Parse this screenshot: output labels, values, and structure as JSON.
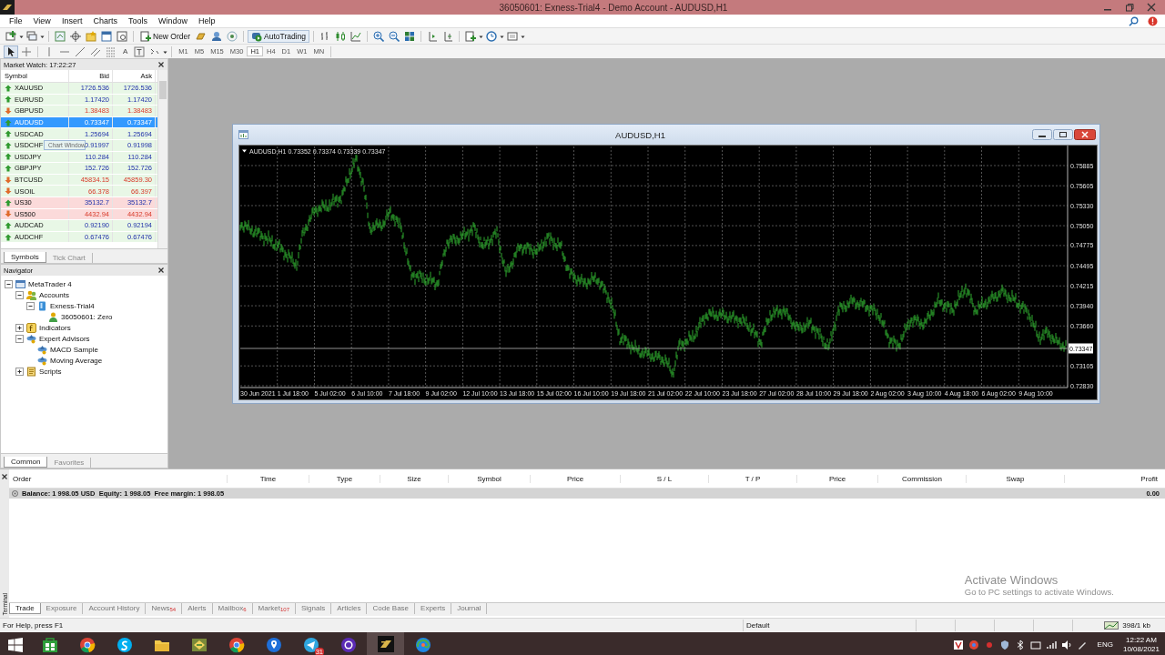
{
  "window": {
    "title": "36050601: Exness-Trial4 - Demo Account - AUDUSD,H1"
  },
  "menu": [
    "File",
    "View",
    "Insert",
    "Charts",
    "Tools",
    "Window",
    "Help"
  ],
  "toolbar": {
    "new_order": "New Order",
    "auto_trading": "AutoTrading",
    "text_tool": "A",
    "timeframes": [
      {
        "label": "M1",
        "selected": false
      },
      {
        "label": "M5",
        "selected": false
      },
      {
        "label": "M15",
        "selected": false
      },
      {
        "label": "M30",
        "selected": false
      },
      {
        "label": "H1",
        "selected": true
      },
      {
        "label": "H4",
        "selected": false
      },
      {
        "label": "D1",
        "selected": false
      },
      {
        "label": "W1",
        "selected": false
      },
      {
        "label": "MN",
        "selected": false
      }
    ]
  },
  "market_watch": {
    "title": "Market Watch: 17:22:27",
    "columns": [
      "Symbol",
      "Bid",
      "Ask"
    ],
    "rows": [
      {
        "symbol": "XAUUSD",
        "bid": "1726.536",
        "ask": "1726.536",
        "rising": true,
        "flagged": false,
        "selected": false
      },
      {
        "symbol": "EURUSD",
        "bid": "1.17420",
        "ask": "1.17420",
        "rising": true,
        "flagged": false,
        "selected": false
      },
      {
        "symbol": "GBPUSD",
        "bid": "1.38483",
        "ask": "1.38483",
        "rising": false,
        "flagged": false,
        "selected": false
      },
      {
        "symbol": "AUDUSD",
        "bid": "0.73347",
        "ask": "0.73347",
        "rising": true,
        "flagged": false,
        "selected": true
      },
      {
        "symbol": "USDCAD",
        "bid": "1.25694",
        "ask": "1.25694",
        "rising": true,
        "flagged": false,
        "selected": false
      },
      {
        "symbol": "USDCHF",
        "bid": "0.91997",
        "ask": "0.91998",
        "rising": true,
        "flagged": false,
        "selected": false
      },
      {
        "symbol": "USDJPY",
        "bid": "110.284",
        "ask": "110.284",
        "rising": true,
        "flagged": false,
        "selected": false
      },
      {
        "symbol": "GBPJPY",
        "bid": "152.726",
        "ask": "152.726",
        "rising": true,
        "flagged": false,
        "selected": false
      },
      {
        "symbol": "BTCUSD",
        "bid": "45834.15",
        "ask": "45859.30",
        "rising": false,
        "flagged": false,
        "selected": false
      },
      {
        "symbol": "USOIL",
        "bid": "66.378",
        "ask": "66.397",
        "rising": false,
        "flagged": false,
        "selected": false
      },
      {
        "symbol": "US30",
        "bid": "35132.7",
        "ask": "35132.7",
        "rising": true,
        "flagged": true,
        "selected": false
      },
      {
        "symbol": "US500",
        "bid": "4432.94",
        "ask": "4432.94",
        "rising": false,
        "flagged": true,
        "selected": false
      },
      {
        "symbol": "AUDCAD",
        "bid": "0.92190",
        "ask": "0.92194",
        "rising": true,
        "flagged": false,
        "selected": false
      },
      {
        "symbol": "AUDCHF",
        "bid": "0.67476",
        "ask": "0.67476",
        "rising": true,
        "flagged": false,
        "selected": false
      }
    ],
    "tabs": [
      {
        "label": "Symbols",
        "selected": true
      },
      {
        "label": "Tick Chart",
        "selected": false
      }
    ]
  },
  "drag_ghost": {
    "label": "Chart Window"
  },
  "navigator": {
    "title": "Navigator",
    "tree": [
      {
        "label": "MetaTrader 4",
        "kind": "terminal",
        "expanded": true,
        "children": [
          {
            "label": "Accounts",
            "kind": "accounts",
            "expanded": true,
            "children": [
              {
                "label": "Exness-Trial4",
                "kind": "server",
                "expanded": true,
                "children": [
                  {
                    "label": "36050601: Zero",
                    "kind": "account"
                  }
                ]
              }
            ]
          },
          {
            "label": "Indicators",
            "kind": "indicators",
            "expanded": false
          },
          {
            "label": "Expert Advisors",
            "kind": "experts",
            "expanded": true,
            "children": [
              {
                "label": "MACD Sample",
                "kind": "expert"
              },
              {
                "label": "Moving Average",
                "kind": "expert"
              }
            ]
          },
          {
            "label": "Scripts",
            "kind": "scripts",
            "expanded": false
          }
        ]
      }
    ],
    "tabs": [
      {
        "label": "Common",
        "selected": true
      },
      {
        "label": "Favorites",
        "selected": false
      }
    ]
  },
  "chart_window": {
    "title": "AUDUSD,H1",
    "info": "AUDUSD,H1  0.73352 0.73374 0.73339 0.73347",
    "price_labels": [
      "0.75885",
      "0.75605",
      "0.75330",
      "0.75050",
      "0.74775",
      "0.74495",
      "0.74215",
      "0.73940",
      "0.73660",
      "0.73105",
      "0.72830"
    ],
    "current_price": "0.73347",
    "time_labels": [
      "30 Jun 2021",
      "1 Jul 18:00",
      "5 Jul 02:00",
      "6 Jul 10:00",
      "7 Jul 18:00",
      "9 Jul 02:00",
      "12 Jul 10:00",
      "13 Jul 18:00",
      "15 Jul 02:00",
      "16 Jul 10:00",
      "19 Jul 18:00",
      "21 Jul 02:00",
      "22 Jul 10:00",
      "23 Jul 18:00",
      "27 Jul 02:00",
      "28 Jul 10:00",
      "29 Jul 18:00",
      "2 Aug 02:00",
      "3 Aug 10:00",
      "4 Aug 18:00",
      "6 Aug 02:00",
      "9 Aug 10:00"
    ]
  },
  "terminal": {
    "label": "Terminal",
    "columns": [
      "Order",
      "Time",
      "Type",
      "Size",
      "Symbol",
      "Price",
      "S / L",
      "T / P",
      "Price",
      "Commission",
      "Swap",
      "Profit"
    ],
    "balance": "Balance: 1 998.05 USD  Equity: 1 998.05  Free margin: 1 998.05",
    "profit": "0.00",
    "tabs": [
      {
        "label": "Trade",
        "selected": true
      },
      {
        "label": "Exposure",
        "selected": false
      },
      {
        "label": "Account History",
        "selected": false
      },
      {
        "label": "News",
        "badge": "54",
        "selected": false
      },
      {
        "label": "Alerts",
        "selected": false
      },
      {
        "label": "Mailbox",
        "badge": "6",
        "selected": false
      },
      {
        "label": "Market",
        "badge": "107",
        "selected": false
      },
      {
        "label": "Signals",
        "selected": false
      },
      {
        "label": "Articles",
        "selected": false
      },
      {
        "label": "Code Base",
        "selected": false
      },
      {
        "label": "Experts",
        "selected": false
      },
      {
        "label": "Journal",
        "selected": false
      }
    ]
  },
  "activation_notice": {
    "title": "Activate Windows",
    "text": "Go to PC settings to activate Windows."
  },
  "status_bar": {
    "help": "For Help, press F1",
    "profile": "Default",
    "traffic": "398/1 kb"
  },
  "taskbar": {
    "apps": [
      {
        "kind": "store",
        "selected": false
      },
      {
        "kind": "browser",
        "selected": false
      },
      {
        "kind": "chat",
        "selected": false
      },
      {
        "kind": "folder",
        "selected": false
      },
      {
        "kind": "trader",
        "selected": false
      },
      {
        "kind": "browser",
        "selected": false
      },
      {
        "kind": "pin",
        "selected": false
      },
      {
        "kind": "messenger",
        "badge": "31",
        "selected": false
      },
      {
        "kind": "ring",
        "selected": false
      },
      {
        "kind": "exness",
        "selected": true
      },
      {
        "kind": "swirl",
        "selected": false
      }
    ],
    "language": "ENG",
    "time": "12:22 AM",
    "date": "10/08/2021"
  }
}
